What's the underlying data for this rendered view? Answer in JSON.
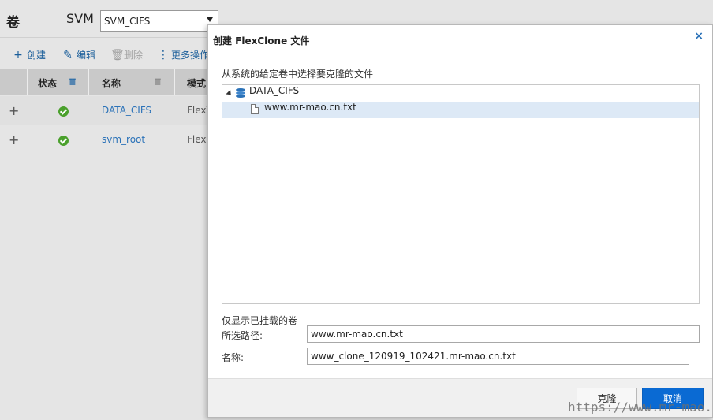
{
  "app": {
    "page_title": "卷",
    "svm_label": "SVM",
    "svm_selected": "SVM_CIFS"
  },
  "toolbar": {
    "create_label": "创建",
    "edit_label": "编辑",
    "delete_label": "删除",
    "more_label": "更多操作"
  },
  "grid": {
    "columns": {
      "status": "状态",
      "name": "名称",
      "mode": "模式"
    },
    "rows": [
      {
        "name": "DATA_CIFS",
        "mode": "FlexV"
      },
      {
        "name": "svm_root",
        "mode": "FlexV"
      }
    ]
  },
  "dialog": {
    "title": "创建 FlexClone 文件",
    "close_glyph": "×",
    "instruction": "从系统的给定卷中选择要克隆的文件",
    "tree": {
      "root_label": "DATA_CIFS",
      "child_label": "www.mr-mao.cn.txt"
    },
    "mounted_note": "仅显示已挂载的卷",
    "selected_path_label": "所选路径:",
    "selected_path_value": "www.mr-mao.cn.txt",
    "name_label": "名称:",
    "name_value": "www_clone_120919_102421.mr-mao.cn.txt",
    "clone_button": "克隆",
    "cancel_button": "取消"
  },
  "watermark": "https://www.mr-mao.cn",
  "colors": {
    "accent": "#0a6ad3",
    "link": "#2b72b8",
    "ok": "#4aa02c"
  },
  "icons": [
    "plus-icon",
    "pencil-icon",
    "trash-icon",
    "more-vertical-icon",
    "filter-icon",
    "check-circle-icon",
    "database-icon",
    "file-icon",
    "close-icon",
    "chevron-down-icon",
    "tree-expander-icon"
  ]
}
